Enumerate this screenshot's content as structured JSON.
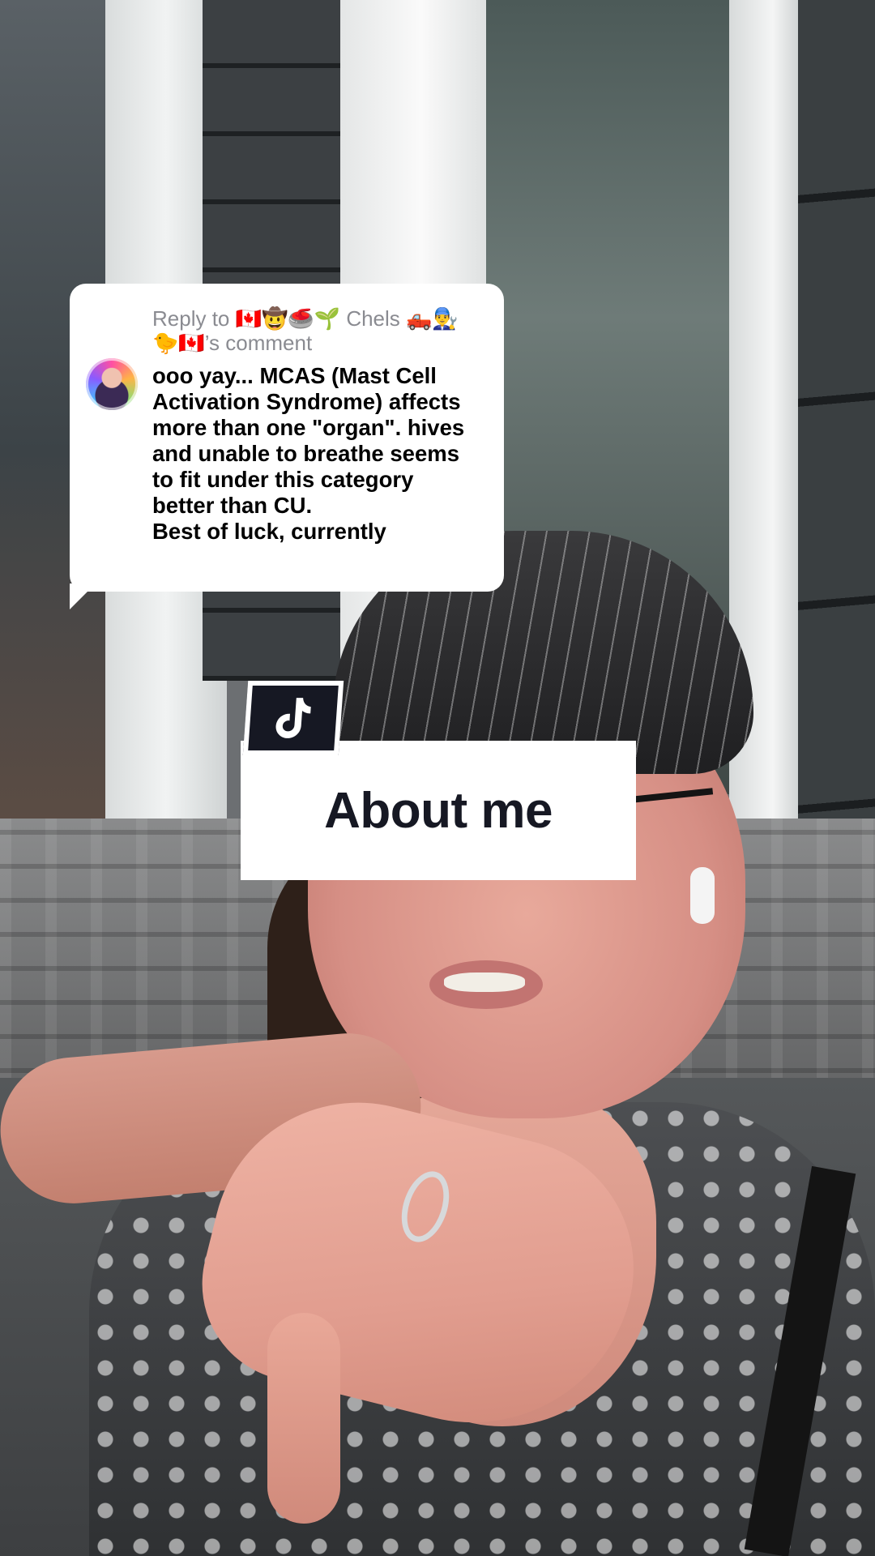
{
  "reply_comment": {
    "header": "Reply to 🇨🇦🤠🥌🌱 Chels 🛻👨‍🔧🐤🇨🇦’s comment",
    "body": "ooo yay... MCAS (Mast Cell Activation Syndrome) affects more than one \"organ\". hives and unable to breathe seems to fit under this category better than CU.\nBest of luck, currently",
    "avatar_icon": "rainbow-avatar"
  },
  "sticker": {
    "icon": "tiktok-logo-icon",
    "title": "About me"
  },
  "colors": {
    "bubble_bg": "#ffffff",
    "header_text": "#8a8b91",
    "body_text": "#000000",
    "badge_bg": "#161823",
    "title_text": "#161823"
  }
}
